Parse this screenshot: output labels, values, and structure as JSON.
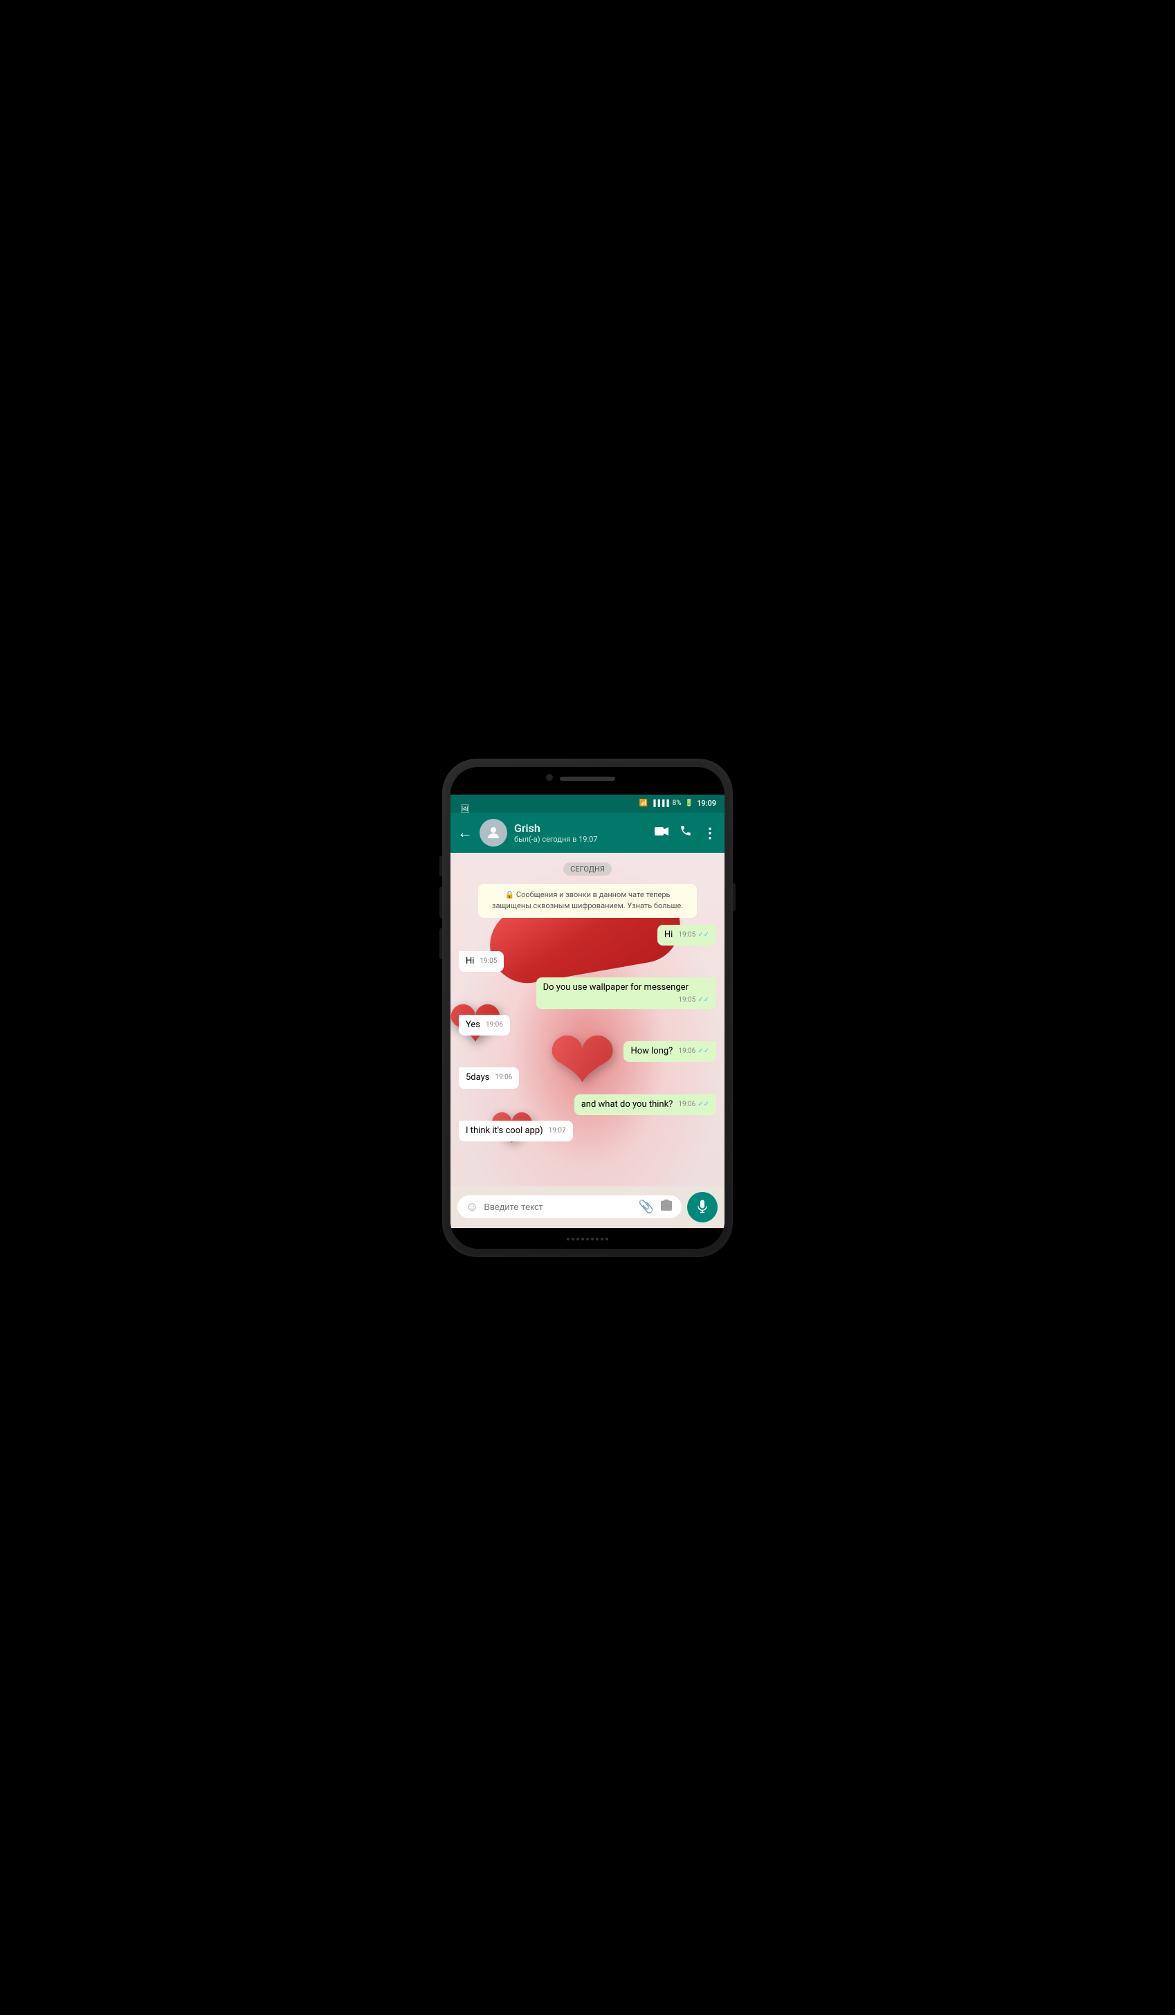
{
  "statusBar": {
    "time": "19:09",
    "battery": "8%",
    "wifiIcon": "wifi",
    "signalIcon": "signal",
    "batteryIcon": "battery",
    "notifIcon": "image"
  },
  "header": {
    "contactName": "Grish",
    "contactStatus": "был(-а) сегодня в 19:07",
    "backLabel": "←",
    "videoIcon": "video-camera",
    "callIcon": "phone",
    "menuIcon": "more-vertical"
  },
  "dateBadge": "СЕГОДНЯ",
  "systemMessage": "🔒 Сообщения и звонки в данном чате теперь защищены сквозным шифрованием. Узнать больше.",
  "messages": [
    {
      "id": 1,
      "type": "sent",
      "text": "Hi",
      "time": "19:05",
      "status": "read"
    },
    {
      "id": 2,
      "type": "received",
      "text": "Hi",
      "time": "19:05"
    },
    {
      "id": 3,
      "type": "sent",
      "text": "Do you use wallpaper for messenger",
      "time": "19:05",
      "status": "read"
    },
    {
      "id": 4,
      "type": "received",
      "text": "Yes",
      "time": "19:06"
    },
    {
      "id": 5,
      "type": "sent",
      "text": "How long?",
      "time": "19:06",
      "status": "read"
    },
    {
      "id": 6,
      "type": "received",
      "text": "5days",
      "time": "19:06"
    },
    {
      "id": 7,
      "type": "sent",
      "text": "and what do you think?",
      "time": "19:06",
      "status": "read"
    },
    {
      "id": 8,
      "type": "received",
      "text": "I think it's cool app)",
      "time": "19:07"
    }
  ],
  "inputArea": {
    "placeholder": "Введите текст",
    "emojiIcon": "emoji",
    "attachIcon": "paperclip",
    "cameraIcon": "camera",
    "micIcon": "microphone"
  }
}
